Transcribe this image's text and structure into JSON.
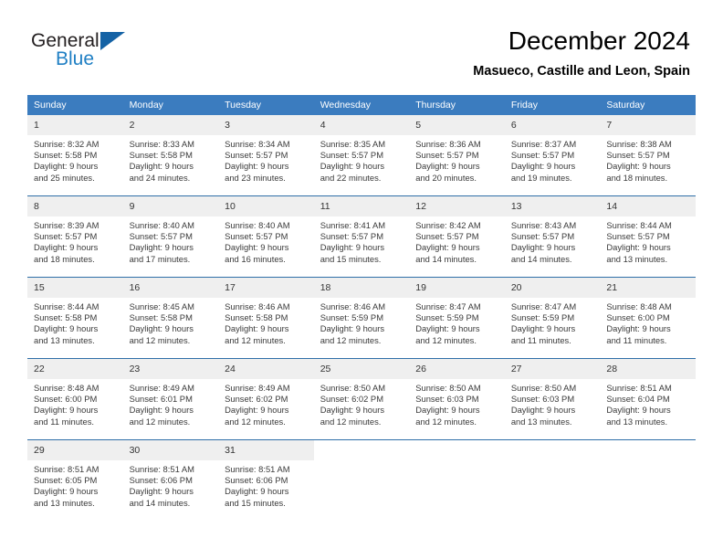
{
  "brand": {
    "name_part1": "General",
    "name_part2": "Blue",
    "triangle_color": "#1462a5",
    "blue_text_color": "#1f7fc4"
  },
  "header": {
    "title": "December 2024",
    "subtitle": "Masueco, Castille and Leon, Spain"
  },
  "theme": {
    "header_row_bg": "#3b7cbf",
    "daynum_bg": "#efefef",
    "row_divider": "#2f6fa8"
  },
  "weekdays": [
    "Sunday",
    "Monday",
    "Tuesday",
    "Wednesday",
    "Thursday",
    "Friday",
    "Saturday"
  ],
  "days": [
    {
      "n": "1",
      "sunrise": "Sunrise: 8:32 AM",
      "sunset": "Sunset: 5:58 PM",
      "daylight1": "Daylight: 9 hours",
      "daylight2": "and 25 minutes."
    },
    {
      "n": "2",
      "sunrise": "Sunrise: 8:33 AM",
      "sunset": "Sunset: 5:58 PM",
      "daylight1": "Daylight: 9 hours",
      "daylight2": "and 24 minutes."
    },
    {
      "n": "3",
      "sunrise": "Sunrise: 8:34 AM",
      "sunset": "Sunset: 5:57 PM",
      "daylight1": "Daylight: 9 hours",
      "daylight2": "and 23 minutes."
    },
    {
      "n": "4",
      "sunrise": "Sunrise: 8:35 AM",
      "sunset": "Sunset: 5:57 PM",
      "daylight1": "Daylight: 9 hours",
      "daylight2": "and 22 minutes."
    },
    {
      "n": "5",
      "sunrise": "Sunrise: 8:36 AM",
      "sunset": "Sunset: 5:57 PM",
      "daylight1": "Daylight: 9 hours",
      "daylight2": "and 20 minutes."
    },
    {
      "n": "6",
      "sunrise": "Sunrise: 8:37 AM",
      "sunset": "Sunset: 5:57 PM",
      "daylight1": "Daylight: 9 hours",
      "daylight2": "and 19 minutes."
    },
    {
      "n": "7",
      "sunrise": "Sunrise: 8:38 AM",
      "sunset": "Sunset: 5:57 PM",
      "daylight1": "Daylight: 9 hours",
      "daylight2": "and 18 minutes."
    },
    {
      "n": "8",
      "sunrise": "Sunrise: 8:39 AM",
      "sunset": "Sunset: 5:57 PM",
      "daylight1": "Daylight: 9 hours",
      "daylight2": "and 18 minutes."
    },
    {
      "n": "9",
      "sunrise": "Sunrise: 8:40 AM",
      "sunset": "Sunset: 5:57 PM",
      "daylight1": "Daylight: 9 hours",
      "daylight2": "and 17 minutes."
    },
    {
      "n": "10",
      "sunrise": "Sunrise: 8:40 AM",
      "sunset": "Sunset: 5:57 PM",
      "daylight1": "Daylight: 9 hours",
      "daylight2": "and 16 minutes."
    },
    {
      "n": "11",
      "sunrise": "Sunrise: 8:41 AM",
      "sunset": "Sunset: 5:57 PM",
      "daylight1": "Daylight: 9 hours",
      "daylight2": "and 15 minutes."
    },
    {
      "n": "12",
      "sunrise": "Sunrise: 8:42 AM",
      "sunset": "Sunset: 5:57 PM",
      "daylight1": "Daylight: 9 hours",
      "daylight2": "and 14 minutes."
    },
    {
      "n": "13",
      "sunrise": "Sunrise: 8:43 AM",
      "sunset": "Sunset: 5:57 PM",
      "daylight1": "Daylight: 9 hours",
      "daylight2": "and 14 minutes."
    },
    {
      "n": "14",
      "sunrise": "Sunrise: 8:44 AM",
      "sunset": "Sunset: 5:57 PM",
      "daylight1": "Daylight: 9 hours",
      "daylight2": "and 13 minutes."
    },
    {
      "n": "15",
      "sunrise": "Sunrise: 8:44 AM",
      "sunset": "Sunset: 5:58 PM",
      "daylight1": "Daylight: 9 hours",
      "daylight2": "and 13 minutes."
    },
    {
      "n": "16",
      "sunrise": "Sunrise: 8:45 AM",
      "sunset": "Sunset: 5:58 PM",
      "daylight1": "Daylight: 9 hours",
      "daylight2": "and 12 minutes."
    },
    {
      "n": "17",
      "sunrise": "Sunrise: 8:46 AM",
      "sunset": "Sunset: 5:58 PM",
      "daylight1": "Daylight: 9 hours",
      "daylight2": "and 12 minutes."
    },
    {
      "n": "18",
      "sunrise": "Sunrise: 8:46 AM",
      "sunset": "Sunset: 5:59 PM",
      "daylight1": "Daylight: 9 hours",
      "daylight2": "and 12 minutes."
    },
    {
      "n": "19",
      "sunrise": "Sunrise: 8:47 AM",
      "sunset": "Sunset: 5:59 PM",
      "daylight1": "Daylight: 9 hours",
      "daylight2": "and 12 minutes."
    },
    {
      "n": "20",
      "sunrise": "Sunrise: 8:47 AM",
      "sunset": "Sunset: 5:59 PM",
      "daylight1": "Daylight: 9 hours",
      "daylight2": "and 11 minutes."
    },
    {
      "n": "21",
      "sunrise": "Sunrise: 8:48 AM",
      "sunset": "Sunset: 6:00 PM",
      "daylight1": "Daylight: 9 hours",
      "daylight2": "and 11 minutes."
    },
    {
      "n": "22",
      "sunrise": "Sunrise: 8:48 AM",
      "sunset": "Sunset: 6:00 PM",
      "daylight1": "Daylight: 9 hours",
      "daylight2": "and 11 minutes."
    },
    {
      "n": "23",
      "sunrise": "Sunrise: 8:49 AM",
      "sunset": "Sunset: 6:01 PM",
      "daylight1": "Daylight: 9 hours",
      "daylight2": "and 12 minutes."
    },
    {
      "n": "24",
      "sunrise": "Sunrise: 8:49 AM",
      "sunset": "Sunset: 6:02 PM",
      "daylight1": "Daylight: 9 hours",
      "daylight2": "and 12 minutes."
    },
    {
      "n": "25",
      "sunrise": "Sunrise: 8:50 AM",
      "sunset": "Sunset: 6:02 PM",
      "daylight1": "Daylight: 9 hours",
      "daylight2": "and 12 minutes."
    },
    {
      "n": "26",
      "sunrise": "Sunrise: 8:50 AM",
      "sunset": "Sunset: 6:03 PM",
      "daylight1": "Daylight: 9 hours",
      "daylight2": "and 12 minutes."
    },
    {
      "n": "27",
      "sunrise": "Sunrise: 8:50 AM",
      "sunset": "Sunset: 6:03 PM",
      "daylight1": "Daylight: 9 hours",
      "daylight2": "and 13 minutes."
    },
    {
      "n": "28",
      "sunrise": "Sunrise: 8:51 AM",
      "sunset": "Sunset: 6:04 PM",
      "daylight1": "Daylight: 9 hours",
      "daylight2": "and 13 minutes."
    },
    {
      "n": "29",
      "sunrise": "Sunrise: 8:51 AM",
      "sunset": "Sunset: 6:05 PM",
      "daylight1": "Daylight: 9 hours",
      "daylight2": "and 13 minutes."
    },
    {
      "n": "30",
      "sunrise": "Sunrise: 8:51 AM",
      "sunset": "Sunset: 6:06 PM",
      "daylight1": "Daylight: 9 hours",
      "daylight2": "and 14 minutes."
    },
    {
      "n": "31",
      "sunrise": "Sunrise: 8:51 AM",
      "sunset": "Sunset: 6:06 PM",
      "daylight1": "Daylight: 9 hours",
      "daylight2": "and 15 minutes."
    }
  ],
  "grid": {
    "leading_blanks": 0,
    "trailing_blanks": 4,
    "weeks": 5
  }
}
